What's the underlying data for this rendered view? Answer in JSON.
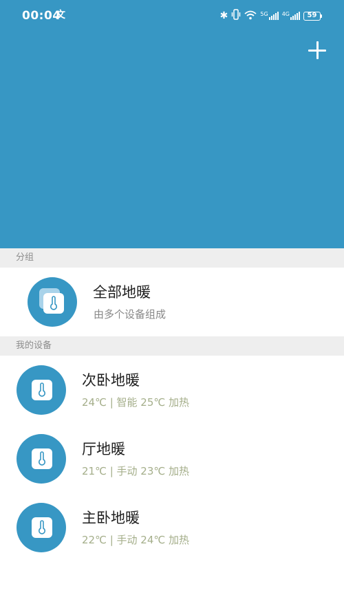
{
  "status_bar": {
    "time": "00:04",
    "app_icon_glyph": "文",
    "right_icons": [
      "bluetooth-icon",
      "vibrate-icon",
      "wifi-icon",
      "signal-5g-icon",
      "signal-4g-icon",
      "battery-icon"
    ],
    "net1_label": "5G",
    "net2_label": "4G",
    "battery": "59"
  },
  "header": {
    "add_icon": "plus-icon",
    "color": "#3797c4"
  },
  "groups_section": {
    "label": "分组",
    "items": [
      {
        "title": "全部地暖",
        "subtitle": "由多个设备组成",
        "icon": "thermometer-group-icon"
      }
    ]
  },
  "devices_section": {
    "label": "我的设备",
    "items": [
      {
        "title": "次卧地暖",
        "status": "24℃ | 智能 25℃ 加热",
        "icon": "thermometer-icon"
      },
      {
        "title": "厅地暖",
        "status": "21℃ | 手动 23℃ 加热",
        "icon": "thermometer-icon"
      },
      {
        "title": "主卧地暖",
        "status": "22℃ | 手动 24℃ 加热",
        "icon": "thermometer-icon"
      }
    ]
  },
  "colors": {
    "accent": "#3797c4",
    "section_bg": "#eeeeee",
    "status_text": "#a4ae8a"
  }
}
